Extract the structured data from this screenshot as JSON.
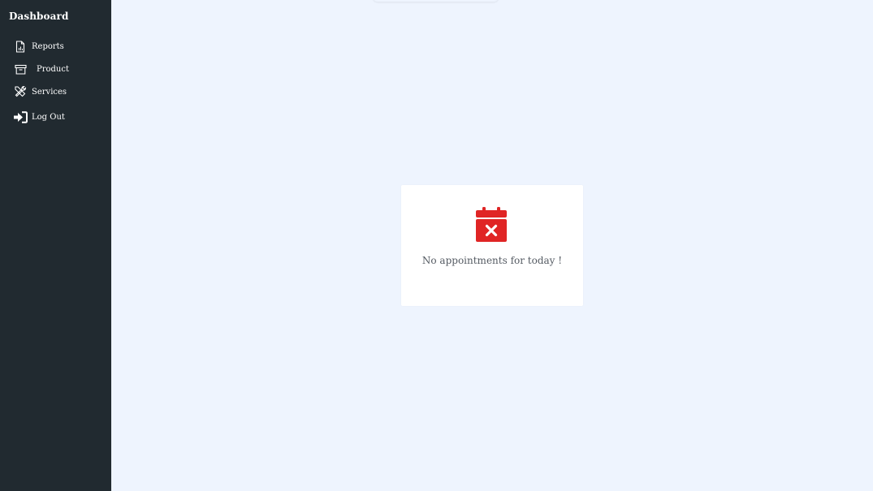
{
  "sidebar": {
    "brand": "Dashboard",
    "items": [
      {
        "label": "Reports",
        "icon": "file-chart-icon"
      },
      {
        "label": "Product",
        "icon": "archive-icon"
      },
      {
        "label": "Services",
        "icon": "tools-icon"
      },
      {
        "label": "Log Out",
        "icon": "sign-in-arrow-icon"
      }
    ]
  },
  "main": {
    "empty_state": {
      "message": "No appointments for today !",
      "icon": "calendar-x-icon"
    }
  },
  "colors": {
    "sidebar_bg": "#212a30",
    "page_bg": "#eef4fe",
    "card_bg": "#ffffff",
    "accent_red": "#e02525"
  }
}
